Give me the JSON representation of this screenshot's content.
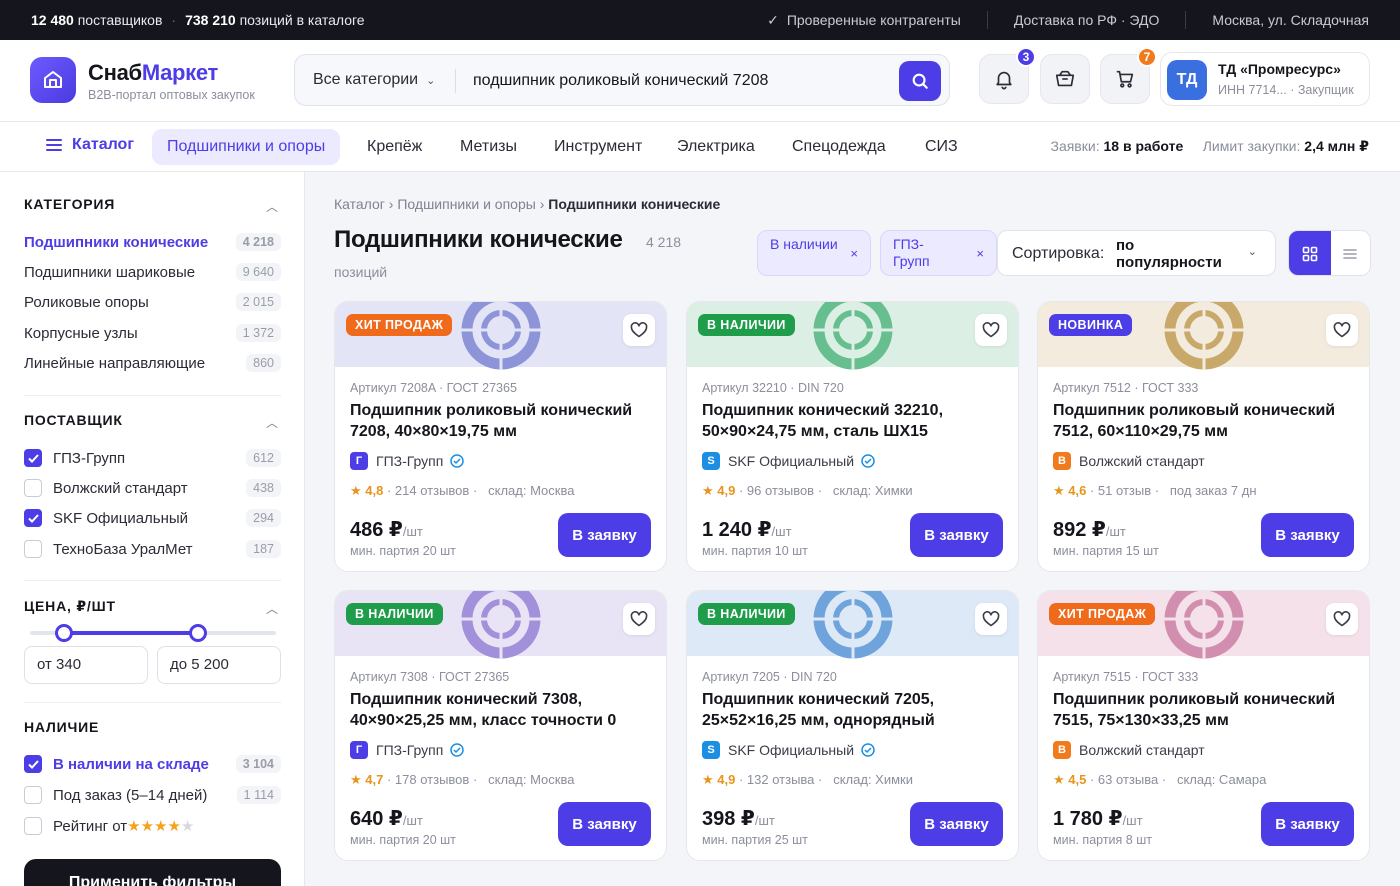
{
  "topbar": {
    "suppliers_num": "12 480",
    "suppliers_txt": "поставщиков",
    "positions_num": "738 210",
    "positions_txt": "позиций в каталоге",
    "verified": "Проверенные контрагенты",
    "delivery": "Доставка по РФ · ЭДО",
    "address": "Москва, ул. Складочная"
  },
  "header": {
    "brand_a": "Снаб",
    "brand_b": "Маркет",
    "tagline": "B2B-портал оптовых закупок",
    "search_category": "Все категории",
    "search_value": "подшипник роликовый конический 7208",
    "notifications_count": "3",
    "cart_count": "7",
    "account_initials": "ТД",
    "account_name": "ТД «Промресурс»",
    "account_meta": "ИНН 7714... · Закупщик"
  },
  "nav": {
    "catalog_label": "Каталог",
    "tabs": [
      "Подшипники и опоры",
      "Крепёж",
      "Метизы",
      "Инструмент",
      "Электрика",
      "Спецодежда",
      "СИЗ"
    ],
    "requests_label": "Заявки:",
    "requests_value": "18 в работе",
    "limit_label": "Лимит закупки:",
    "limit_value": "2,4 млн ₽"
  },
  "filters": {
    "category_title": "КАТЕГОРИЯ",
    "categories": [
      {
        "label": "Подшипники конические",
        "count": "4 218"
      },
      {
        "label": "Подшипники шариковые",
        "count": "9 640"
      },
      {
        "label": "Роликовые опоры",
        "count": "2 015"
      },
      {
        "label": "Корпусные узлы",
        "count": "1 372"
      },
      {
        "label": "Линейные направляющие",
        "count": "860"
      }
    ],
    "supplier_title": "ПОСТАВЩИК",
    "suppliers": [
      {
        "label": "ГПЗ-Групп",
        "count": "612"
      },
      {
        "label": "Волжский стандарт",
        "count": "438"
      },
      {
        "label": "SKF Официальный",
        "count": "294"
      },
      {
        "label": "ТехноБаза УралМет",
        "count": "187"
      }
    ],
    "price_title": "ЦЕНА, ₽/ШТ",
    "price_from": "от 340",
    "price_to": "до 5 200",
    "availability_title": "НАЛИЧИЕ",
    "availability": [
      {
        "label": "В наличии на складе",
        "count": "3 104"
      },
      {
        "label": "Под заказ (5–14 дней)",
        "count": "1 114"
      }
    ],
    "rating_label": "Рейтинг от",
    "rating_min": 4,
    "apply_label": "Применить фильтры"
  },
  "main": {
    "crumbs": [
      "Каталог",
      "Подшипники и опоры",
      "Подшипники конические"
    ],
    "title": "Подшипники конические",
    "count": "4 218",
    "count_unit": "позиций",
    "chips": [
      "В наличии",
      "ГПЗ-Групп"
    ],
    "sort_label": "Сортировка:",
    "sort_value": "по популярности"
  },
  "products": [
    {
      "badge": "ХИТ ПРОДАЖ",
      "badge_color": "#f06a1c",
      "tint": "#e3e5f7",
      "ring": "#8e94d8",
      "article": "Артикул 7208A · ГОСТ 27365",
      "name": "Подшипник роликовый конический 7208, 40×80×19,75 мм",
      "supplier_letter": "Г",
      "supplier_color": "#4d3de6",
      "supplier": "ГПЗ-Групп",
      "verified": true,
      "rating": "4,8",
      "reviews": "214 отзывов",
      "stock": "склад: Москва",
      "price": "486 ₽",
      "unit": "/шт",
      "min": "мин. партия 20 шт",
      "cta": "В заявку"
    },
    {
      "badge": "В НАЛИЧИИ",
      "badge_color": "#1f9d4a",
      "tint": "#dcefe4",
      "ring": "#67be8f",
      "article": "Артикул 32210 · DIN 720",
      "name": "Подшипник конический 32210, 50×90×24,75 мм, сталь ШХ15",
      "supplier_letter": "S",
      "supplier_color": "#1a8fe3",
      "supplier": "SKF Официальный",
      "verified": true,
      "rating": "4,9",
      "reviews": "96 отзывов",
      "stock": "склад: Химки",
      "price": "1 240 ₽",
      "unit": "/шт",
      "min": "мин. партия 10 шт",
      "cta": "В заявку"
    },
    {
      "badge": "НОВИНКА",
      "badge_color": "#4d3de6",
      "tint": "#f3ebde",
      "ring": "#c9a96a",
      "article": "Артикул 7512 · ГОСТ 333",
      "name": "Подшипник роликовый конический 7512, 60×110×29,75 мм",
      "supplier_letter": "В",
      "supplier_color": "#f07a1c",
      "supplier": "Волжский стандарт",
      "verified": false,
      "rating": "4,6",
      "reviews": "51 отзыв",
      "stock": "под заказ 7 дн",
      "price": "892 ₽",
      "unit": "/шт",
      "min": "мин. партия 15 шт",
      "cta": "В заявку"
    },
    {
      "badge": "В НАЛИЧИИ",
      "badge_color": "#1f9d4a",
      "tint": "#e9e3f6",
      "ring": "#a290da",
      "article": "Артикул 7308 · ГОСТ 27365",
      "name": "Подшипник конический 7308, 40×90×25,25 мм, класс точности 0",
      "supplier_letter": "Г",
      "supplier_color": "#4d3de6",
      "supplier": "ГПЗ-Групп",
      "verified": true,
      "rating": "4,7",
      "reviews": "178 отзывов",
      "stock": "склад: Москва",
      "price": "640 ₽",
      "unit": "/шт",
      "min": "мин. партия 20 шт",
      "cta": "В заявку"
    },
    {
      "badge": "В НАЛИЧИИ",
      "badge_color": "#1f9d4a",
      "tint": "#dde9f6",
      "ring": "#6fa3dc",
      "article": "Артикул 7205 · DIN 720",
      "name": "Подшипник конический 7205, 25×52×16,25 мм, однорядный",
      "supplier_letter": "S",
      "supplier_color": "#1a8fe3",
      "supplier": "SKF Официальный",
      "verified": true,
      "rating": "4,9",
      "reviews": "132 отзыва",
      "stock": "склад: Химки",
      "price": "398 ₽",
      "unit": "/шт",
      "min": "мин. партия 25 шт",
      "cta": "В заявку"
    },
    {
      "badge": "ХИТ ПРОДАЖ",
      "badge_color": "#f06a1c",
      "tint": "#f5e1ea",
      "ring": "#d28eae",
      "article": "Артикул 7515 · ГОСТ 333",
      "name": "Подшипник роликовый конический 7515, 75×130×33,25 мм",
      "supplier_letter": "В",
      "supplier_color": "#f07a1c",
      "supplier": "Волжский стандарт",
      "verified": false,
      "rating": "4,5",
      "reviews": "63 отзыва",
      "stock": "склад: Самара",
      "price": "1 780 ₽",
      "unit": "/шт",
      "min": "мин. партия 8 шт",
      "cta": "В заявку"
    }
  ]
}
